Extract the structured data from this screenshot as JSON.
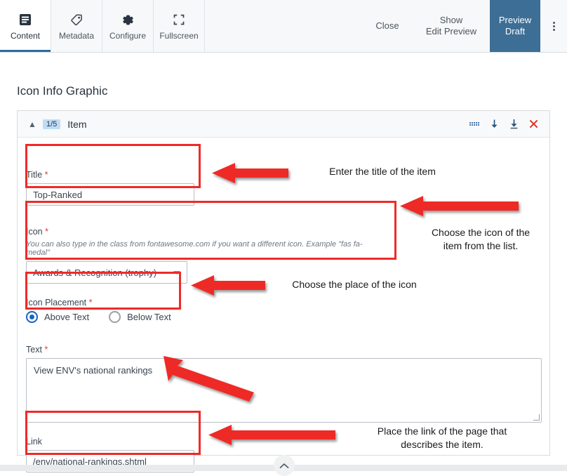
{
  "toolbar": {
    "tabs": [
      {
        "label": "Content",
        "icon": "content-icon"
      },
      {
        "label": "Metadata",
        "icon": "tag-icon"
      },
      {
        "label": "Configure",
        "icon": "gear-icon"
      },
      {
        "label": "Fullscreen",
        "icon": "fullscreen-icon"
      }
    ],
    "close_label": "Close",
    "show_edit_preview_label": "Show\nEdit Preview",
    "show_edit_preview_line1": "Show",
    "show_edit_preview_line2": "Edit Preview",
    "preview_draft_line1": "Preview",
    "preview_draft_line2": "Draft",
    "accent_color": "#3d6e96",
    "active_tab_underline": "#2c6d9e"
  },
  "page": {
    "title": "Icon Info Graphic"
  },
  "panel": {
    "counter": "1/5",
    "title": "Item",
    "collapse_icon": "chevron-up-icon",
    "header_icons": [
      {
        "name": "drag-handle-icon"
      },
      {
        "name": "move-down-icon"
      },
      {
        "name": "move-to-bottom-icon"
      },
      {
        "name": "remove-icon"
      }
    ],
    "badge_bg": "#bedcf5"
  },
  "form": {
    "title_field": {
      "label": "Title",
      "required": true,
      "value": "Top-Ranked"
    },
    "icon_field": {
      "label": "Icon",
      "required": true,
      "helper": "You can also type in the class from fontawesome.com if you want a different icon. Example \"fas fa-medal\"",
      "selected": "Awards & Recognition (trophy)"
    },
    "icon_placement_field": {
      "label": "Icon Placement",
      "required": true,
      "options": [
        {
          "label": "Above Text",
          "selected": true
        },
        {
          "label": "Below Text",
          "selected": false
        }
      ]
    },
    "text_field": {
      "label": "Text",
      "required": true,
      "value": "View ENV's national rankings"
    },
    "link_field": {
      "label": "Link",
      "required": false,
      "value": "/env/national-rankings.shtml"
    }
  },
  "annotations": [
    {
      "text": "Enter the title of the item"
    },
    {
      "line1": "Choose the icon of the",
      "line2": "item from the list."
    },
    {
      "text": "Choose the place of the icon"
    },
    {
      "line1": "Place the link of the page that",
      "line2": "describes the item."
    }
  ],
  "highlight_color": "#ee2b28",
  "footer": {
    "scroll_up_icon": "chevron-up-icon"
  }
}
